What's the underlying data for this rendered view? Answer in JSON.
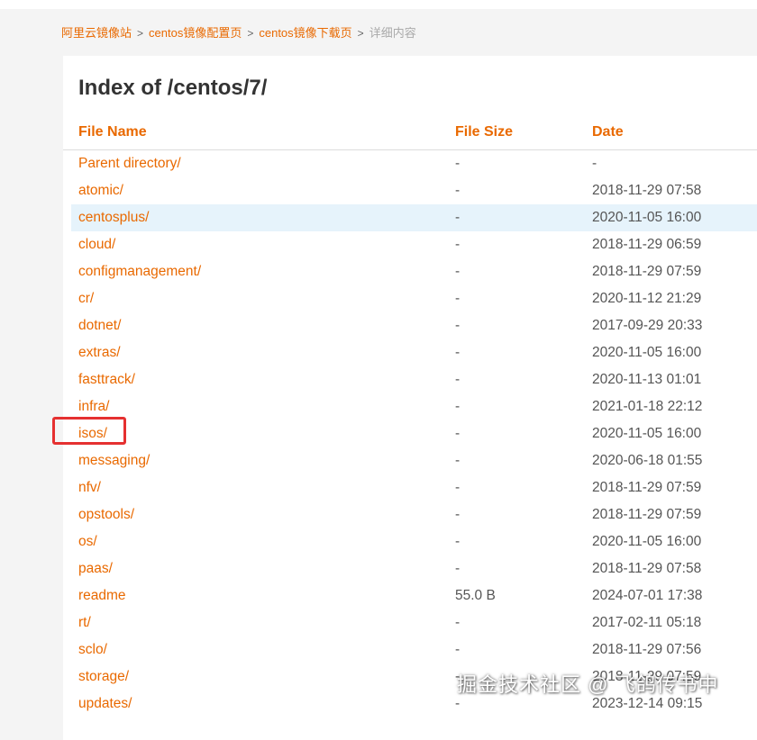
{
  "breadcrumb": {
    "items": [
      "阿里云镜像站",
      "centos镜像配置页",
      "centos镜像下载页",
      "详细内容"
    ],
    "separator": ">"
  },
  "page": {
    "title": "Index of /centos/7/"
  },
  "table": {
    "headers": {
      "name": "File Name",
      "size": "File Size",
      "date": "Date"
    },
    "rows": [
      {
        "name": "Parent directory/",
        "size": "-",
        "date": "-"
      },
      {
        "name": "atomic/",
        "size": "-",
        "date": "2018-11-29 07:58"
      },
      {
        "name": "centosplus/",
        "size": "-",
        "date": "2020-11-05 16:00"
      },
      {
        "name": "cloud/",
        "size": "-",
        "date": "2018-11-29 06:59"
      },
      {
        "name": "configmanagement/",
        "size": "-",
        "date": "2018-11-29 07:59"
      },
      {
        "name": "cr/",
        "size": "-",
        "date": "2020-11-12 21:29"
      },
      {
        "name": "dotnet/",
        "size": "-",
        "date": "2017-09-29 20:33"
      },
      {
        "name": "extras/",
        "size": "-",
        "date": "2020-11-05 16:00"
      },
      {
        "name": "fasttrack/",
        "size": "-",
        "date": "2020-11-13 01:01"
      },
      {
        "name": "infra/",
        "size": "-",
        "date": "2021-01-18 22:12"
      },
      {
        "name": "isos/",
        "size": "-",
        "date": "2020-11-05 16:00"
      },
      {
        "name": "messaging/",
        "size": "-",
        "date": "2020-06-18 01:55"
      },
      {
        "name": "nfv/",
        "size": "-",
        "date": "2018-11-29 07:59"
      },
      {
        "name": "opstools/",
        "size": "-",
        "date": "2018-11-29 07:59"
      },
      {
        "name": "os/",
        "size": "-",
        "date": "2020-11-05 16:00"
      },
      {
        "name": "paas/",
        "size": "-",
        "date": "2018-11-29 07:58"
      },
      {
        "name": "readme",
        "size": "55.0 B",
        "date": "2024-07-01 17:38"
      },
      {
        "name": "rt/",
        "size": "-",
        "date": "2017-02-11 05:18"
      },
      {
        "name": "sclo/",
        "size": "-",
        "date": "2018-11-29 07:56"
      },
      {
        "name": "storage/",
        "size": "-",
        "date": "2018-11-29 07:59"
      },
      {
        "name": "updates/",
        "size": "-",
        "date": "2023-12-14 09:15"
      }
    ]
  },
  "hovered_row": "centosplus/",
  "annotated_row": "isos/",
  "watermark": "掘金技术社区 @ 飞鸽传书中",
  "colors": {
    "link": "#e96900",
    "hover_row": "#e6f3fb",
    "annotation": "#e53030",
    "text": "#555555"
  }
}
